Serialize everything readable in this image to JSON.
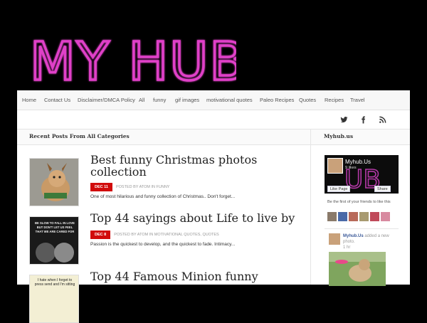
{
  "site": {
    "logo_text": "MY HUB"
  },
  "nav": {
    "items": [
      {
        "label": "Home"
      },
      {
        "label": "Contact Us"
      },
      {
        "label": "Disclaimer/DMCA Policy"
      },
      {
        "label": "All"
      },
      {
        "label": "funny"
      },
      {
        "label": "gif images"
      },
      {
        "label": "motivational quotes"
      },
      {
        "label": "Paleo Recipes"
      },
      {
        "label": "Quotes"
      },
      {
        "label": "Recipes"
      },
      {
        "label": "Travel"
      }
    ]
  },
  "social": {
    "icons": [
      "twitter-icon",
      "facebook-icon",
      "rss-icon"
    ]
  },
  "main": {
    "section_title": "Recent Posts From All Categories",
    "posts": [
      {
        "title": "Best funny Christmas photos collection",
        "date": "DEC 11",
        "meta": "POSTED BY ATOM IN FUNNY",
        "excerpt": "One of most hilarious and funny collection of Christmas.. Don't forget..."
      },
      {
        "title": "Top 44 sayings about Life to live by",
        "date": "DEC 8",
        "meta": "POSTED BY ATOM IN MOTIVATIONAL QUOTES, QUOTES",
        "excerpt": "Passion is the quickest to develop, and the quickest to fade. Intimacy...",
        "thumb_text": "Be slow to fall in love. But don't let us feel that we are cared for and supported."
      },
      {
        "title": "Top 44 Famous Minion funny",
        "thumb_text": "I hate when I forget to press send and I'm sitting"
      }
    ]
  },
  "sidebar": {
    "title": "Myhub.us",
    "fb": {
      "page_name": "Myhub.Us",
      "likes": "9 likes",
      "like_button": "Like Page",
      "share_button": "Share",
      "friends_text": "Be the first of your friends to like this",
      "feed_name": "Myhub.Us",
      "feed_text": "added a new photo.",
      "feed_time": "1 hr"
    }
  },
  "colors": {
    "accent": "#d10c0c",
    "logo": "#e040c8"
  }
}
